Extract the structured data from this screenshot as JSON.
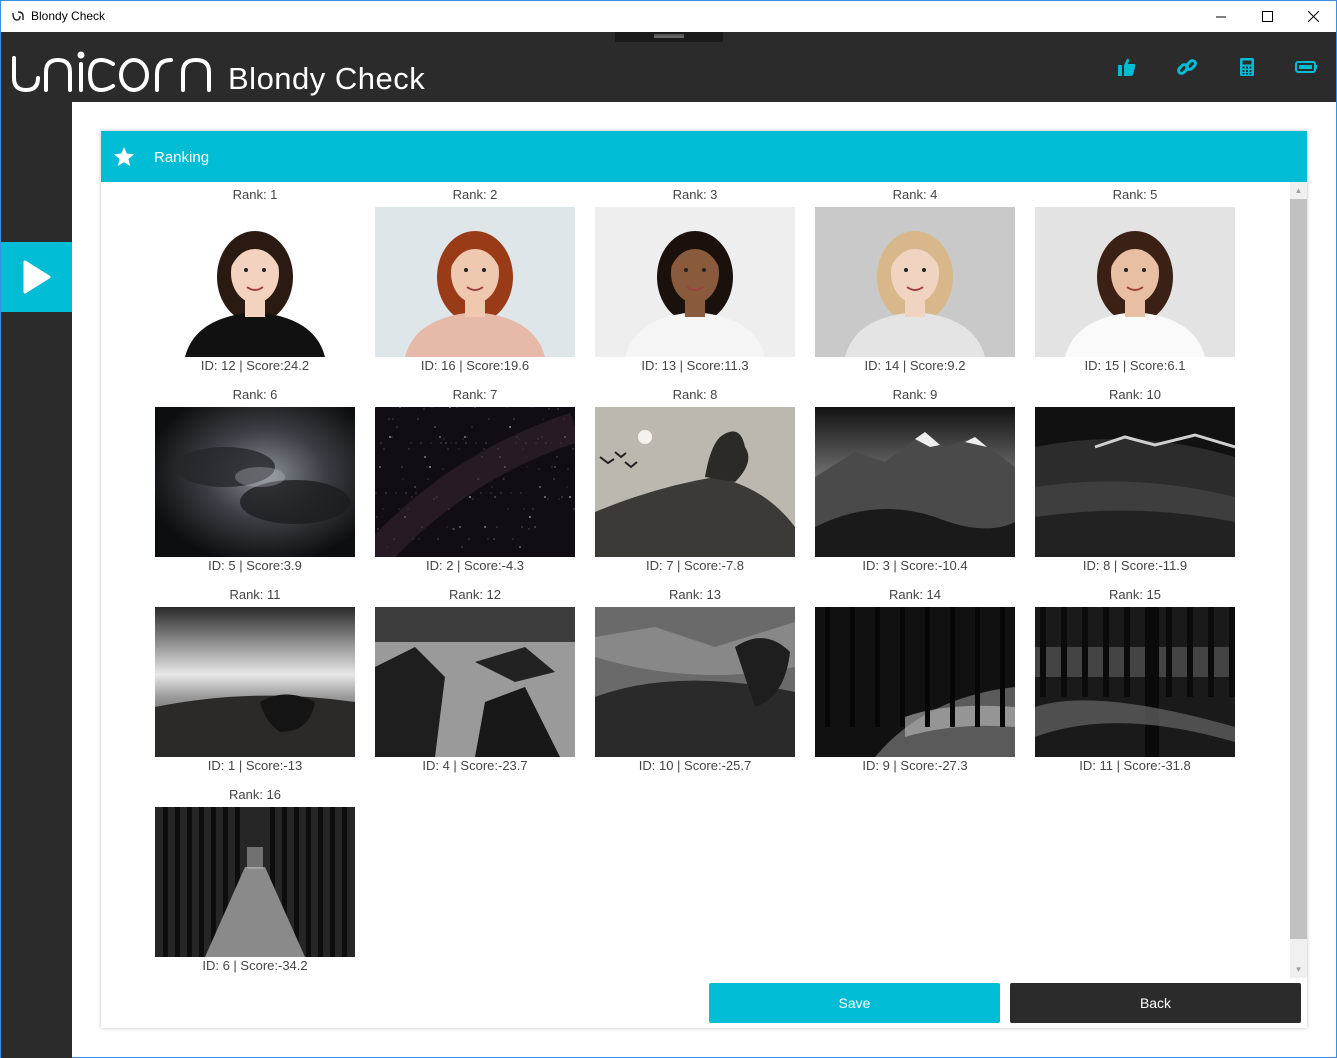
{
  "window": {
    "title": "Blondy Check"
  },
  "header": {
    "logo_text": "unicorn",
    "app_name": "Blondy Check",
    "icons": [
      "thumbs-up-icon",
      "link-icon",
      "calculator-icon",
      "battery-icon"
    ],
    "accent": "#00bcd4",
    "bg": "#2b2b2b"
  },
  "panel": {
    "title": "Ranking",
    "icon": "star-icon"
  },
  "ranking": [
    {
      "rank": "Rank: 1",
      "info": "ID: 12 | Score:24.2",
      "kind": "portrait",
      "tone": "#ffffff",
      "hair": "#2a1a12",
      "shirt": "#111111",
      "skin": "#f3d3bf"
    },
    {
      "rank": "Rank: 2",
      "info": "ID: 16 | Score:19.6",
      "kind": "portrait",
      "tone": "#dfe6ea",
      "hair": "#9a3b18",
      "shirt": "#e7b9a9",
      "skin": "#efc8b0"
    },
    {
      "rank": "Rank: 3",
      "info": "ID: 13 | Score:11.3",
      "kind": "portrait",
      "tone": "#eeeeee",
      "hair": "#1a110c",
      "shirt": "#f5f5f5",
      "skin": "#8a5a3c"
    },
    {
      "rank": "Rank: 4",
      "info": "ID: 14 | Score:9.2",
      "kind": "portrait",
      "tone": "#c9c9c9",
      "hair": "#d8b88a",
      "shirt": "#e4e4e4",
      "skin": "#f1d3c1"
    },
    {
      "rank": "Rank: 5",
      "info": "ID: 15 | Score:6.1",
      "kind": "portrait",
      "tone": "#e3e3e3",
      "hair": "#3a2015",
      "shirt": "#fafafa",
      "skin": "#e9bfa3"
    },
    {
      "rank": "Rank: 6",
      "info": "ID: 5 | Score:3.9",
      "kind": "clouds"
    },
    {
      "rank": "Rank: 7",
      "info": "ID: 2 | Score:-4.3",
      "kind": "stars"
    },
    {
      "rank": "Rank: 8",
      "info": "ID: 7 | Score:-7.8",
      "kind": "hill"
    },
    {
      "rank": "Rank: 9",
      "info": "ID: 3 | Score:-10.4",
      "kind": "mountain"
    },
    {
      "rank": "Rank: 10",
      "info": "ID: 8 | Score:-11.9",
      "kind": "field"
    },
    {
      "rank": "Rank: 11",
      "info": "ID: 1 | Score:-13",
      "kind": "boat"
    },
    {
      "rank": "Rank: 12",
      "info": "ID: 4 | Score:-23.7",
      "kind": "rocks"
    },
    {
      "rank": "Rank: 13",
      "info": "ID: 10 | Score:-25.7",
      "kind": "valley"
    },
    {
      "rank": "Rank: 14",
      "info": "ID: 9 | Score:-27.3",
      "kind": "forest"
    },
    {
      "rank": "Rank: 15",
      "info": "ID: 11 | Score:-31.8",
      "kind": "darkwood"
    },
    {
      "rank": "Rank: 16",
      "info": "ID: 6 | Score:-34.2",
      "kind": "alley"
    }
  ],
  "buttons": {
    "save": "Save",
    "back": "Back"
  }
}
